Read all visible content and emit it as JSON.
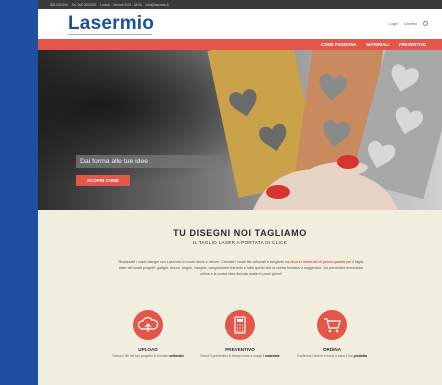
{
  "topbar": {
    "items": [
      "800 000 000",
      "Tel. 000 0000000",
      "Lunedì - Venerdì 9:00 - 18:00",
      "info@lasermio.it"
    ]
  },
  "header": {
    "logo": "Lasermio",
    "login": "Login",
    "cart": "Carrello"
  },
  "nav": {
    "items": [
      "COME FUNZIONA",
      "MATERIALI",
      "PREVENTIVO"
    ]
  },
  "hero": {
    "tagline": "Dai forma alle tue idee",
    "button": "SCOPRI COME"
  },
  "intro": {
    "title": "TU DISEGNI NOI TAGLIAMO",
    "subtitle": "IL TAGLIO LASER A PORTATA DI CLICK",
    "text_before": "Realizzate i vostri disegni con Lasermio in modo facile e veloce. Caricate i vostri file vettoriali e scegliete tra ",
    "text_highlight": "diversi materiali di prima qualità",
    "text_after": " per il taglio laser dei vostri progetti: gadget, decori, targhe, insegne, complementi d'arredo e tutto quello che la vostra fantasia vi suggerisce. Un preventivo immediato online e la vostra idea diventa realtà in pochi giorni!"
  },
  "features": [
    {
      "icon": "cloud-upload-icon",
      "title": "UPLOAD",
      "desc_prefix": "Carica il file del tuo progetto in formato ",
      "desc_bold": "vettoriale"
    },
    {
      "icon": "calculator-icon",
      "title": "PREVENTIVO",
      "desc_prefix": "Ricevi il preventivo in tempo reale e scegli il ",
      "desc_bold": "materiale"
    },
    {
      "icon": "cart-icon",
      "title": "ORDINA",
      "desc_prefix": "Conferma l'ordine e ricevi a casa il tuo ",
      "desc_bold": "prodotto"
    }
  ],
  "colors": {
    "accent": "#e2574a",
    "brand": "#1e4fa0",
    "page_bg": "#f1eee0",
    "frame_bg": "#1f4fa3"
  }
}
